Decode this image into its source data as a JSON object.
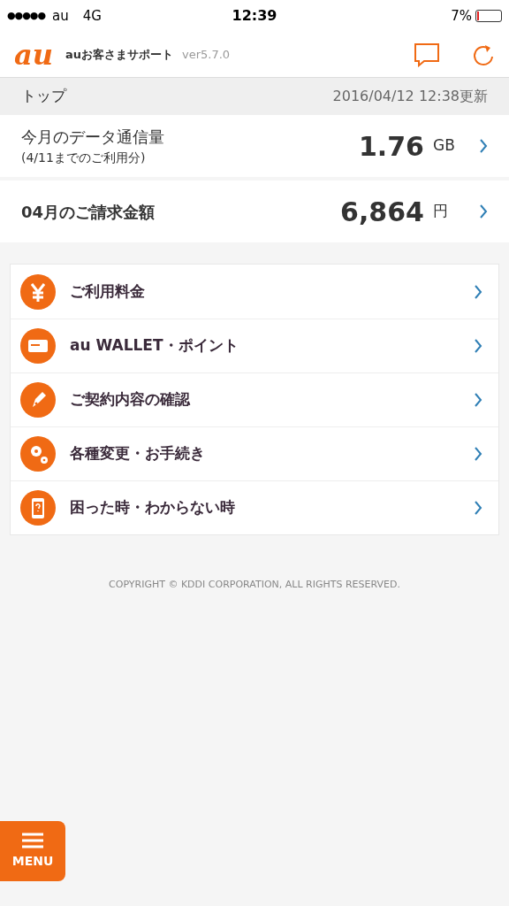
{
  "status_bar": {
    "signal": "●●●●●",
    "carrier": "au",
    "network": "4G",
    "time": "12:39",
    "battery": "7%"
  },
  "header": {
    "logo": "au",
    "title": "auお客さまサポート",
    "version": "ver5.7.0"
  },
  "breadcrumb": {
    "title": "トップ",
    "updated": "2016/04/12 12:38更新"
  },
  "summary": [
    {
      "label": "今月のデータ通信量",
      "note": "(4/11までのご利用分)",
      "value": "1.76",
      "unit": "GB"
    },
    {
      "label": "04月のご請求金額",
      "value": "6,864",
      "unit": "円"
    }
  ],
  "menu_items": [
    {
      "kind": "yen",
      "label": "ご利用料金"
    },
    {
      "kind": "card",
      "label": "au WALLET・ポイント"
    },
    {
      "kind": "pen",
      "label": "ご契約内容の確認"
    },
    {
      "kind": "gears",
      "label": "各種変更・お手続き"
    },
    {
      "kind": "phone",
      "label": "困った時・わからない時"
    }
  ],
  "footer": "COPYRIGHT © KDDI CORPORATION, ALL RIGHTS RESERVED.",
  "menu_button": "MENU"
}
